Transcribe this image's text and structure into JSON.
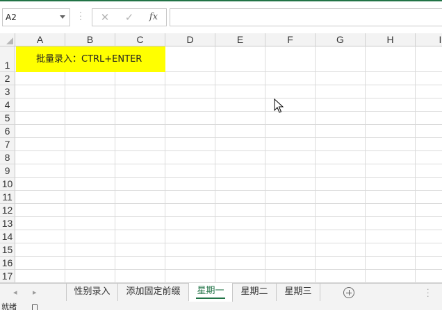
{
  "formula_bar": {
    "name_box": "A2",
    "fx_label": "fx",
    "cancel_icon": "close-icon",
    "enter_icon": "check-icon",
    "formula": ""
  },
  "columns": [
    "A",
    "B",
    "C",
    "D",
    "E",
    "F",
    "G",
    "H",
    "I"
  ],
  "rows": [
    "1",
    "2",
    "3",
    "4",
    "5",
    "6",
    "7",
    "8",
    "9",
    "10",
    "11",
    "12",
    "13",
    "14",
    "15",
    "16",
    "17"
  ],
  "cells": {
    "A1": "批量录入：CTRL+ENTER",
    "A1_fill": "#FFFF00"
  },
  "sheet_tabs": [
    "性别录入",
    "添加固定前缀",
    "星期一",
    "星期二",
    "星期三"
  ],
  "active_tab": "星期一",
  "accent_color": "#217346",
  "status_bar": {
    "ready": "就绪"
  }
}
